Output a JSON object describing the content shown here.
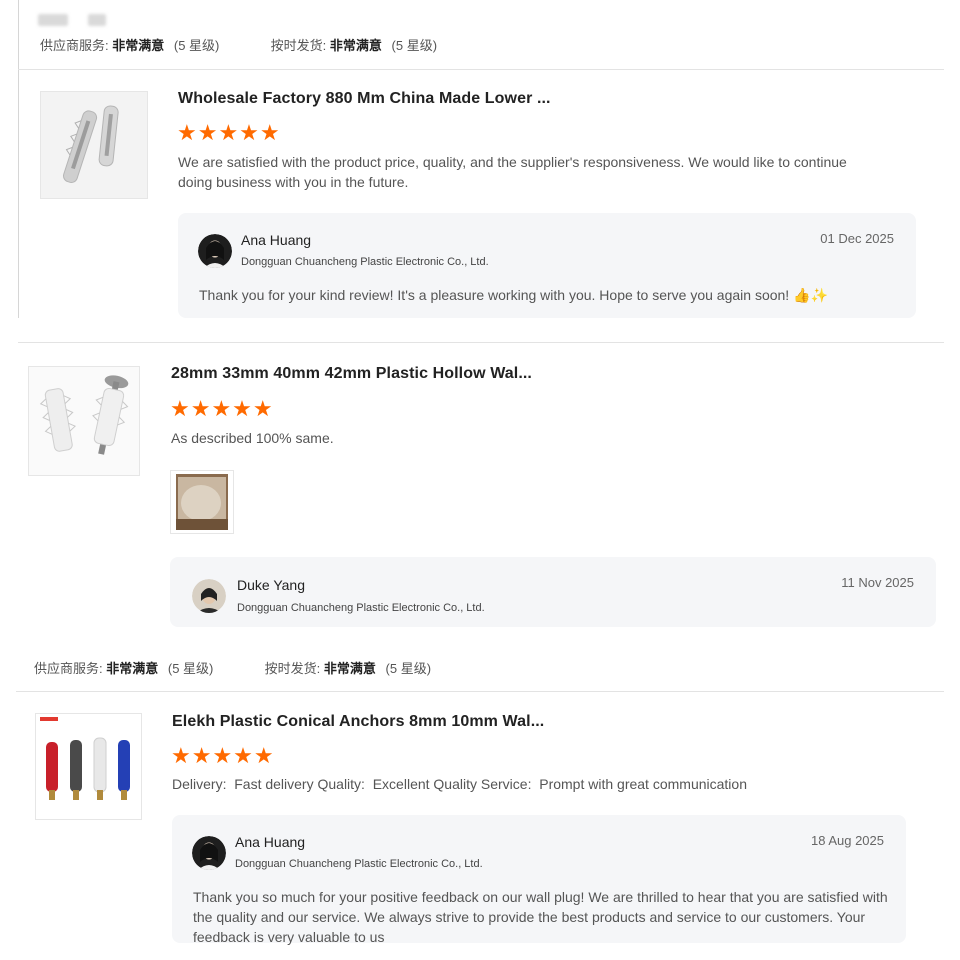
{
  "supplier_rating": {
    "service_label": "供应商服务:",
    "service_value": "非常满意",
    "service_level": "(5 星级)",
    "delivery_label": "按时发货:",
    "delivery_value": "非常满意",
    "delivery_level": "(5 星级)"
  },
  "reviews": [
    {
      "product_title": "Wholesale Factory 880 Mm China Made Lower ...",
      "rating": 5,
      "stars": "★★★★★",
      "text": "We are satisfied with the product price, quality, and the supplier's responsiveness. We would like to continue doing business with you in the future.",
      "reply": {
        "name": "Ana Huang",
        "company": "Dongguan Chuancheng Plastic Electronic Co., Ltd.",
        "date": "01 Dec 2025",
        "text": "Thank you for your kind review! It's a pleasure working with you. Hope to serve you again soon! 👍✨"
      }
    },
    {
      "product_title": "28mm 33mm 40mm 42mm Plastic Hollow Wal...",
      "rating": 5,
      "stars": "★★★★★",
      "text": "As described 100% same.",
      "reply": {
        "name": "Duke Yang",
        "company": "Dongguan Chuancheng Plastic Electronic Co., Ltd.",
        "date": "11 Nov 2025"
      }
    },
    {
      "product_title": "Elekh Plastic Conical Anchors 8mm 10mm Wal...",
      "rating": 5,
      "stars": "★★★★★",
      "text": "Delivery:  Fast delivery Quality:  Excellent Quality Service:  Prompt with great communication",
      "reply": {
        "name": "Ana Huang",
        "company": "Dongguan Chuancheng Plastic Electronic Co., Ltd.",
        "date": "18 Aug 2025",
        "text": "Thank you so much for your positive feedback on our wall plug! We are thrilled to hear that you are satisfied with the quality and our service. We always strive to provide the best products and service to our customers. Your feedback is very valuable to us"
      }
    }
  ],
  "colors": {
    "star": "#ff6a00",
    "reply_bg": "#f5f6f8",
    "divider": "#e3e3e3"
  }
}
